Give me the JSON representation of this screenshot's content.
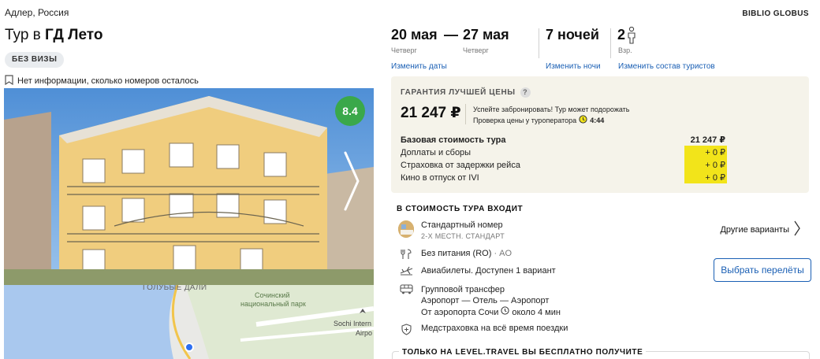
{
  "header": {
    "location": "Адлер, Россия",
    "title_prefix": "Тур в ",
    "title_hotel": "ГД Лето",
    "visa_badge": "БЕЗ ВИЗЫ",
    "rooms_info": "Нет информации, сколько номеров осталось",
    "operator": "BIBLIO GLOBUS"
  },
  "hotel": {
    "rating": "8.4"
  },
  "map": {
    "labels": [
      "ГОЛУБЫЕ ДАЛИ",
      "Сочинский",
      "национальный парк",
      "Sochi Intern",
      "Airpo"
    ]
  },
  "dates": {
    "from": "20 мая",
    "dash": "—",
    "to": "27 мая",
    "from_day": "Четверг",
    "to_day": "Четверг",
    "change_dates": "Изменить даты",
    "nights": "7 ночей",
    "change_nights": "Изменить ночи",
    "tourists_count": "2",
    "tourists_label": "Взр.",
    "change_tourists": "Изменить состав туристов"
  },
  "price": {
    "guarantee": "ГАРАНТИЯ ЛУЧШЕЙ ЦЕНЫ",
    "question": "?",
    "amount": "21 247 ₽",
    "note_line1": "Успейте забронировать! Тур может подорожать",
    "note_line2": "Проверка цены у туроператора",
    "timer": "4:44",
    "rows": [
      {
        "label": "Базовая стоимость тура",
        "value": "21 247 ₽"
      },
      {
        "label": "Доплаты и сборы",
        "value": "+ 0 ₽"
      },
      {
        "label": "Страховка от задержки рейса",
        "value": "+ 0 ₽"
      },
      {
        "label": "Кино в отпуск от IVI",
        "value": "+ 0 ₽"
      }
    ]
  },
  "included": {
    "title": "В СТОИМОСТЬ ТУРА ВХОДИТ",
    "room_name": "Стандартный номер",
    "room_type": "2-Х МЕСТН. СТАНДАРТ",
    "other_options": "Другие варианты",
    "meal": "Без питания (RO)",
    "meal_sep": " · ",
    "meal_code": "AO",
    "flights": "Авиабилеты. Доступен 1 вариант",
    "choose_flights": "Выбрать перелёты",
    "transfer_line1": "Групповой трансфер",
    "transfer_line2": "Аэропорт — Отель — Аэропорт",
    "transfer_line3_a": "От аэропорта Сочи",
    "transfer_line3_b": "около 4 мин",
    "insurance": "Медстраховка на всё время поездки"
  },
  "bonus": {
    "title": "ТОЛЬКО НА LEVEL.TRAVEL ВЫ БЕСПЛАТНО ПОЛУЧИТЕ"
  },
  "colors": {
    "link": "#1a5fb4",
    "rating_bg": "#3aa84a",
    "highlight": "#f2e41a",
    "price_box_bg": "#f5f3ea"
  }
}
